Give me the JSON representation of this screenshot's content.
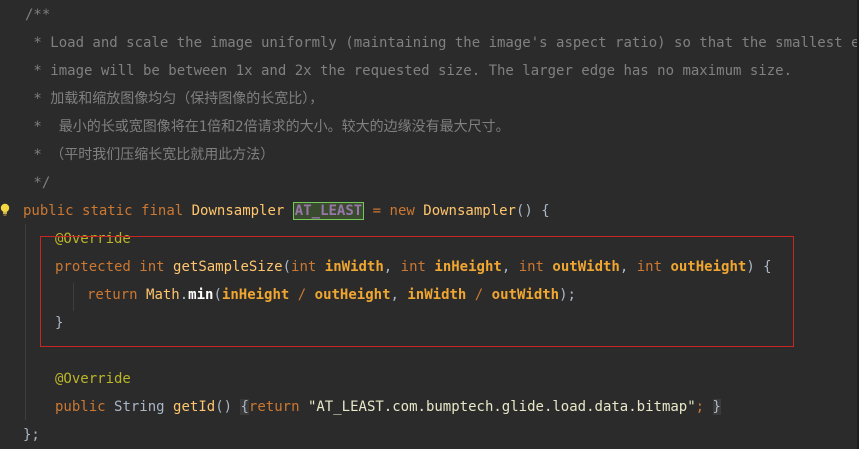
{
  "editor": {
    "lines": {
      "c1": "/**",
      "c2": " * Load and scale the image uniformly (maintaining the image's aspect ratio) so that the smallest edge of",
      "c3": " * image will be between 1x and 2x the requested size. The larger edge has no maximum size.",
      "c4": " * 加载和缩放图像均匀（保持图像的长宽比），",
      "c5": " *  最小的长或宽图像将在1倍和2倍请求的大小。较大的边缘没有最大尺寸。",
      "c6": " * （平时我们压缩长宽比就用此方法）",
      "c7": " */"
    },
    "decl": {
      "kw1": "public",
      "kw2": "static",
      "kw3": "final",
      "type": "Downsampler",
      "field": "AT_LEAST",
      "eq": "=",
      "new": "new",
      "ctor": "Downsampler",
      "tail": "() {"
    },
    "override1": "@Override",
    "method1": {
      "kw": "protected",
      "ret": "int",
      "name": "getSampleSize",
      "open": "(",
      "t1": "int",
      "p1": "inWidth",
      "c1": ", ",
      "t2": "int",
      "p2": "inHeight",
      "c2": ", ",
      "t3": "int",
      "p3": "outWidth",
      "c3": ", ",
      "t4": "int",
      "p4": "outHeight",
      "close": ") {"
    },
    "body1": {
      "kw": "return",
      "cls": "Math",
      "dot": ".",
      "mth": "min",
      "open": "(",
      "a1": "inHeight",
      "div1": " / ",
      "a2": "outHeight",
      "comma": ", ",
      "a3": "inWidth",
      "div2": " / ",
      "a4": "outWidth",
      "close": ");"
    },
    "close1": "}",
    "override2": "@Override",
    "method2": {
      "kw": "public",
      "ret": "String",
      "name": "getId",
      "paren": "()",
      "brace_open": "{",
      "return": "return",
      "string": "\"AT_LEAST.com.bumptech.glide.load.data.bitmap\"",
      "semi": ";",
      "brace_close": "}"
    },
    "end": "};"
  },
  "icons": {
    "gutter": "lightbulb-icon"
  },
  "colors": {
    "background": "#2b2b2b",
    "comment": "#808080",
    "keyword": "#cc7832",
    "class": "#ffc66d",
    "annotation": "#bbb529",
    "field": "#9876aa",
    "parameter": "#f0a732",
    "highlight_border": "#75c95a",
    "annotation_box": "#c82525"
  }
}
